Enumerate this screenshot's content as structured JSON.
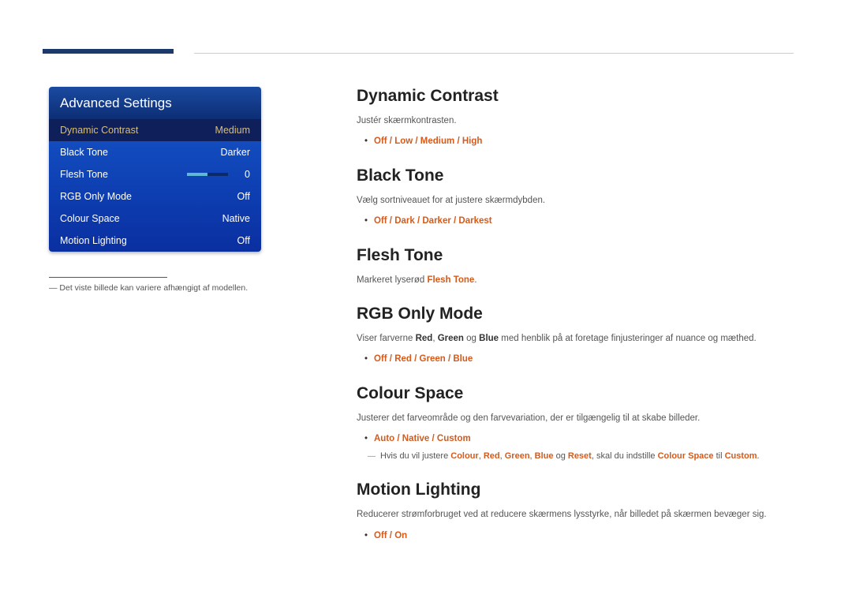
{
  "osd": {
    "title": "Advanced Settings",
    "rows": [
      {
        "label": "Dynamic Contrast",
        "value": "Medium",
        "selected": true
      },
      {
        "label": "Black Tone",
        "value": "Darker"
      },
      {
        "label": "Flesh Tone",
        "value": "0",
        "slider": true
      },
      {
        "label": "RGB Only Mode",
        "value": "Off"
      },
      {
        "label": "Colour Space",
        "value": "Native"
      },
      {
        "label": "Motion Lighting",
        "value": "Off"
      }
    ]
  },
  "left_footnote": "―  Det viste billede kan variere afhængigt af modellen.",
  "sections": {
    "dynamic_contrast": {
      "title": "Dynamic Contrast",
      "desc": "Justér skærmkontrasten.",
      "opts": [
        "Off",
        "Low",
        "Medium",
        "High"
      ]
    },
    "black_tone": {
      "title": "Black Tone",
      "desc": "Vælg sortniveauet for at justere skærmdybden.",
      "opts": [
        "Off",
        "Dark",
        "Darker",
        "Darkest"
      ]
    },
    "flesh_tone": {
      "title": "Flesh Tone",
      "desc_pre": "Markeret lyserød ",
      "desc_bold": "Flesh Tone",
      "desc_post": "."
    },
    "rgb_only": {
      "title": "RGB Only Mode",
      "desc_pre": "Viser farverne ",
      "r": "Red",
      "g": "Green",
      "b": "Blue",
      "mid1": ", ",
      "mid2": " og ",
      "desc_post": " med henblik på at foretage finjusteringer af nuance og mæthed.",
      "opts": [
        "Off",
        "Red",
        "Green",
        "Blue"
      ]
    },
    "colour_space": {
      "title": "Colour Space",
      "desc": "Justerer det farveområde og den farvevariation, der er tilgængelig til at skabe billeder.",
      "opts": [
        "Auto",
        "Native",
        "Custom"
      ],
      "note_pre": "Hvis du vil justere ",
      "w1": "Colour",
      "w2": "Red",
      "w3": "Green",
      "w4": "Blue",
      "w5": "Reset",
      "c": ", ",
      "og": " og ",
      "note_mid": ", skal du indstille ",
      "cs": "Colour Space",
      "til": " til ",
      "custom": "Custom",
      "dot": "."
    },
    "motion_lighting": {
      "title": "Motion Lighting",
      "desc": "Reducerer strømforbruget ved at reducere skærmens lysstyrke, når billedet på skærmen bevæger sig.",
      "opts": [
        "Off",
        "On"
      ]
    }
  },
  "sep": " / "
}
